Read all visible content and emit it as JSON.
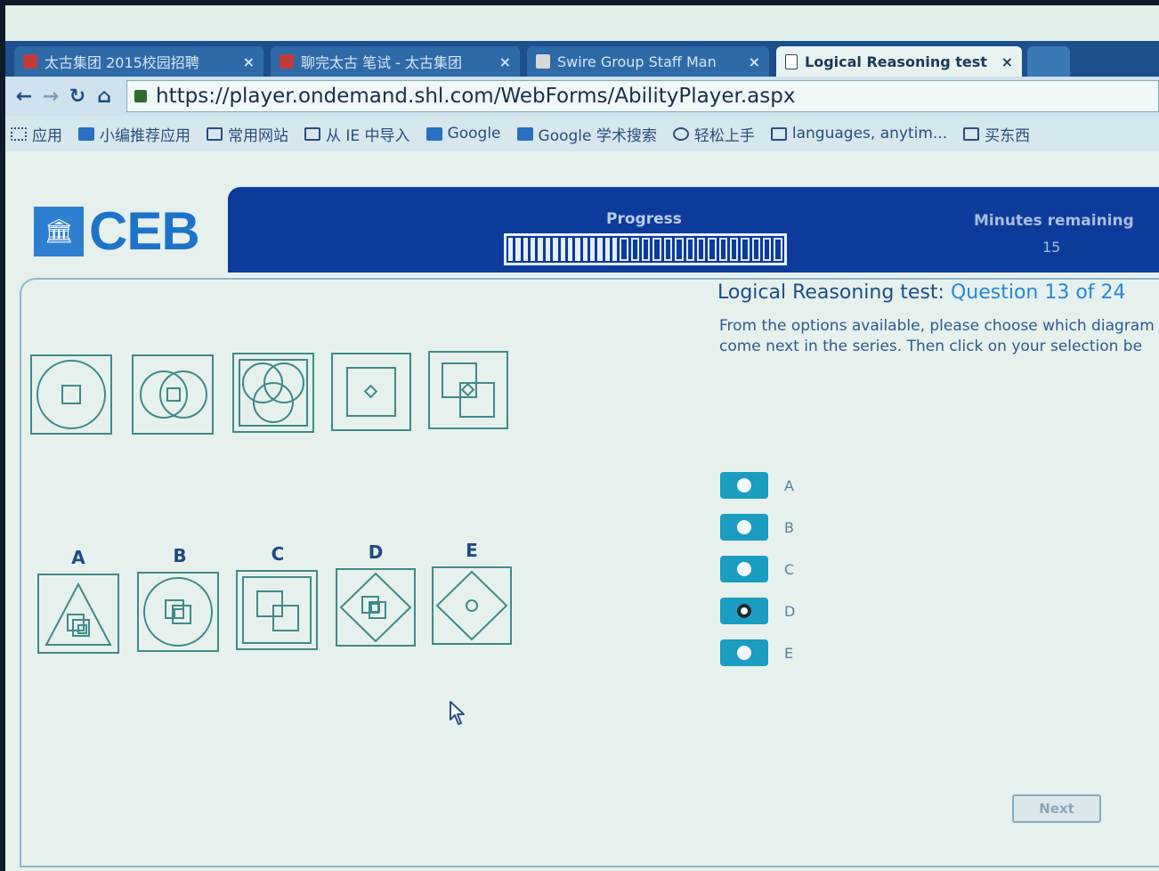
{
  "browser": {
    "tabs": [
      {
        "label": "太古集团 2015校园招聘",
        "active": false
      },
      {
        "label": "聊完太古 笔试 - 太古集团",
        "active": false
      },
      {
        "label": "Swire Group Staff Man",
        "active": false
      },
      {
        "label": "Logical Reasoning test",
        "active": true
      }
    ],
    "tab_close": "×",
    "url": "https://player.ondemand.shl.com/WebForms/AbilityPlayer.aspx",
    "bookmarks": [
      {
        "label": "应用",
        "icon": "apps-icon"
      },
      {
        "label": "小编推荐应用",
        "icon": "bookmark-icon"
      },
      {
        "label": "常用网站",
        "icon": "folder-icon"
      },
      {
        "label": "从 IE 中导入",
        "icon": "folder-icon"
      },
      {
        "label": "Google",
        "icon": "bookmark-icon"
      },
      {
        "label": "Google 学术搜索",
        "icon": "bookmark-icon"
      },
      {
        "label": "轻松上手",
        "icon": "globe-icon"
      },
      {
        "label": "languages, anytim...",
        "icon": "page-icon"
      },
      {
        "label": "买东西",
        "icon": "folder-icon"
      }
    ]
  },
  "header": {
    "logo_text": "CEB",
    "progress_label": "Progress",
    "progress_fraction": 0.5,
    "minutes_label": "Minutes remaining",
    "minutes_value": "15"
  },
  "question": {
    "test_name": "Logical Reasoning test:",
    "question_label": "Question 13 of 24",
    "instruction_line1": "From the options available, please choose which diagram",
    "instruction_line2": "come next in the series. Then click on your selection be"
  },
  "answers": {
    "letters": [
      "A",
      "B",
      "C",
      "D",
      "E"
    ],
    "selected": "D"
  },
  "next_label": "Next",
  "colors": {
    "banner": "#0d3b9c",
    "radio": "#1b9cc1",
    "logo": "#1e73c9"
  }
}
